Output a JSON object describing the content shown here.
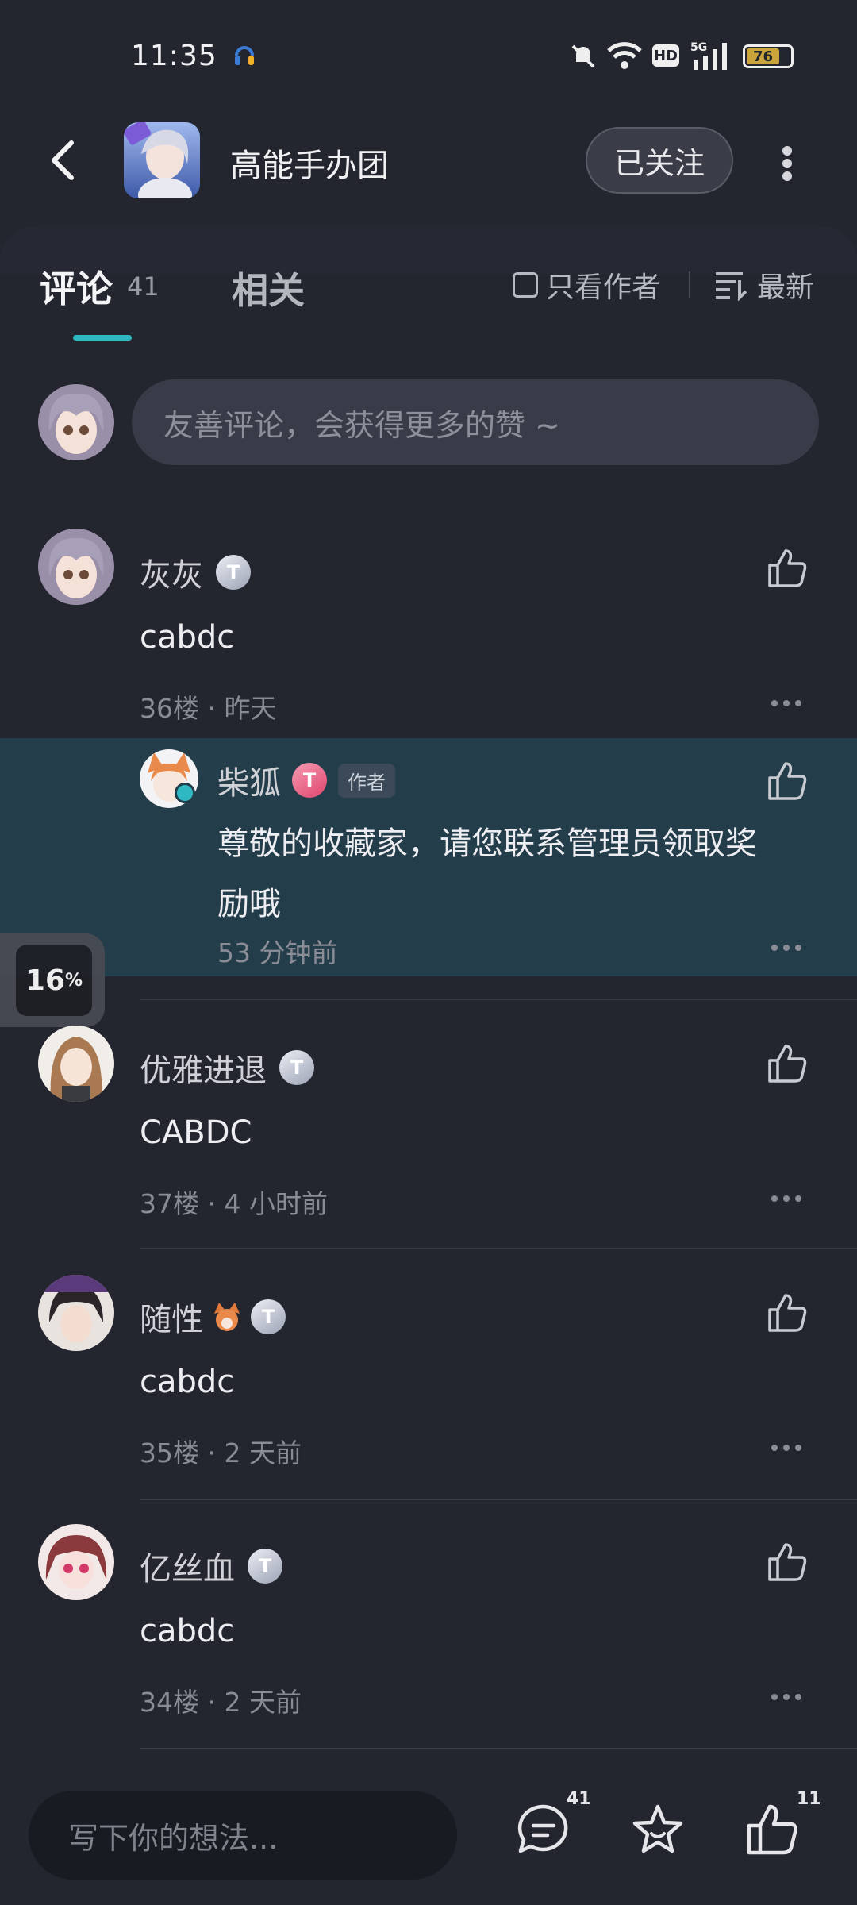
{
  "status_bar": {
    "time": "11:35",
    "battery": "76"
  },
  "app_bar": {
    "title": "高能手办团",
    "follow_label": "已关注"
  },
  "tabs": {
    "comments_label": "评论",
    "comments_count": "41",
    "related_label": "相关",
    "only_author_label": "只看作者",
    "sort_label": "最新"
  },
  "compose": {
    "placeholder": "友善评论，会获得更多的赞 ~"
  },
  "comments": [
    {
      "username": "灰灰",
      "text": "cabdc",
      "meta": "36楼 · 昨天"
    },
    {
      "username": "优雅进退",
      "text": "CABDC",
      "meta": "37楼 · 4 小时前"
    },
    {
      "username": "随性",
      "text": "cabdc",
      "meta": "35楼 · 2 天前"
    },
    {
      "username": "亿丝血",
      "text": "cabdc",
      "meta": "34楼 · 2 天前"
    }
  ],
  "reply": {
    "username": "柴狐",
    "author_tag": "作者",
    "text_line1": "尊敬的收藏家，请您联系管理员领取奖",
    "text_line2": "励哦",
    "meta": "53 分钟前"
  },
  "floating_progress": {
    "value": "16",
    "unit": "%"
  },
  "bottom_bar": {
    "placeholder": "写下你的想法...",
    "comment_count": "41",
    "like_count": "11"
  },
  "colors": {
    "background": "#23252f",
    "accent": "#2fb8c2",
    "reply_highlight": "#233d4a"
  }
}
